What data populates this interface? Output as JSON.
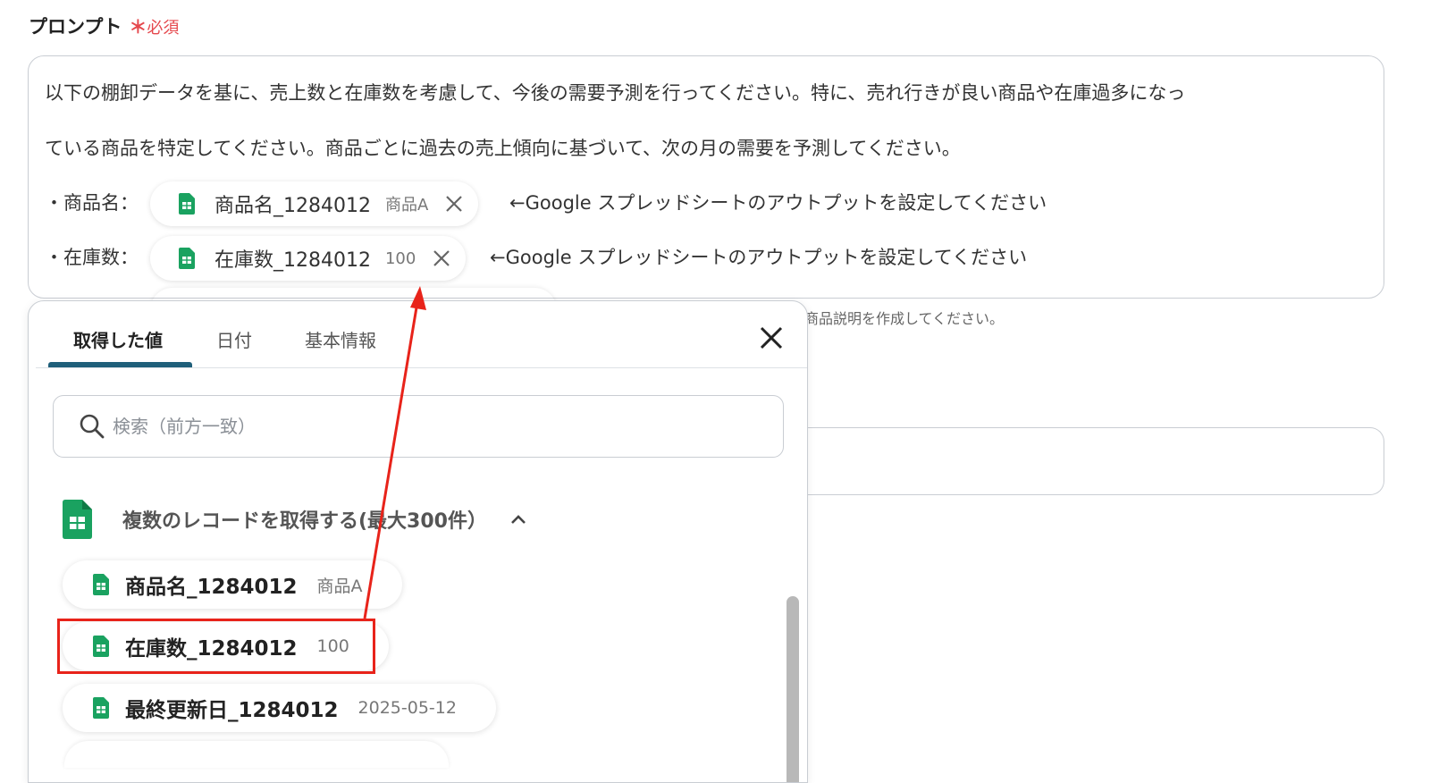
{
  "field": {
    "label": "プロンプト",
    "required_mark": "＊",
    "required_text": "必須"
  },
  "prompt": {
    "line1": "以下の棚卸データを基に、売上数と在庫数を考慮して、今後の需要予測を行ってください。特に、売れ行きが良い商品や在庫過多になっ",
    "line2": "ている商品を特定してください。商品ごとに過去の売上傾向に基づいて、次の月の需要を予測してください。",
    "rows": [
      {
        "label": "・商品名：",
        "chip_name": "商品名_1284012",
        "chip_value": "商品A",
        "hint": "←Google スプレッドシートのアウトプットを設定してください"
      },
      {
        "label": "・在庫数：",
        "chip_name": "在庫数_1284012",
        "chip_value": "100",
        "hint": "←Google スプレッドシートのアウトプットを設定してください"
      }
    ]
  },
  "behind_text": "商品説明を作成してください。",
  "panel": {
    "tabs": [
      "取得した値",
      "日付",
      "基本情報"
    ],
    "active_tab": "取得した値",
    "search_placeholder": "検索（前方一致）",
    "group_title": "複数のレコードを取得する(最大300件）",
    "items": [
      {
        "name": "商品名_1284012",
        "value": "商品A"
      },
      {
        "name": "在庫数_1284012",
        "value": "100"
      },
      {
        "name": "最終更新日_1284012",
        "value": "2025-05-12"
      }
    ]
  },
  "icons": {
    "sheet": "google-sheets-icon",
    "close": "close-icon",
    "search": "search-icon",
    "caret": "chevron-up-icon"
  },
  "colors": {
    "required": "#e5484d",
    "sheets_green": "#1aa260",
    "tab_accent": "#1f5f7a",
    "annotation": "#e8231a"
  }
}
